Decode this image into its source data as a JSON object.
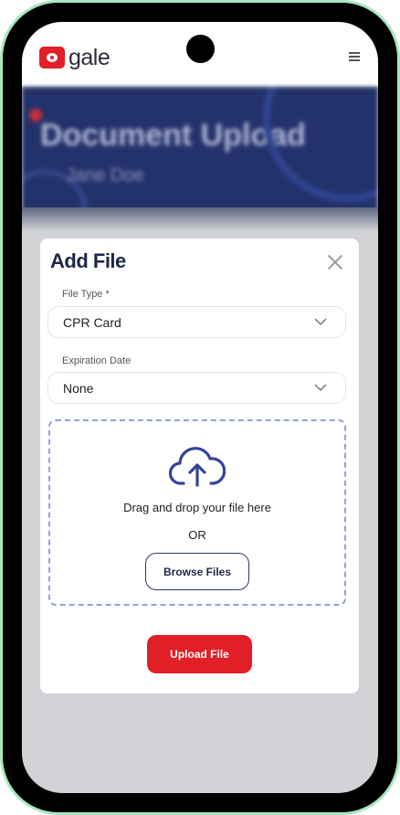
{
  "app": {
    "logo_text": "gale"
  },
  "hero": {
    "title": "Document Upload",
    "subtitle": "Jane Doe"
  },
  "modal": {
    "title": "Add File",
    "file_type": {
      "label": "File Type *",
      "value": "CPR Card"
    },
    "expiration": {
      "label": "Expiration Date",
      "value": "None"
    },
    "dropzone": {
      "text": "Drag and drop your file here",
      "or": "OR",
      "browse_label": "Browse Files"
    },
    "upload_label": "Upload File"
  },
  "colors": {
    "brand_red": "#e11f26",
    "navy": "#1e2747",
    "hero_blue": "#24326b",
    "dashed_border": "#93a0dd",
    "frame_green": "#a8e6bf"
  },
  "icons": [
    "menu-icon",
    "close-icon",
    "chevron-down-icon",
    "cloud-upload-icon"
  ]
}
